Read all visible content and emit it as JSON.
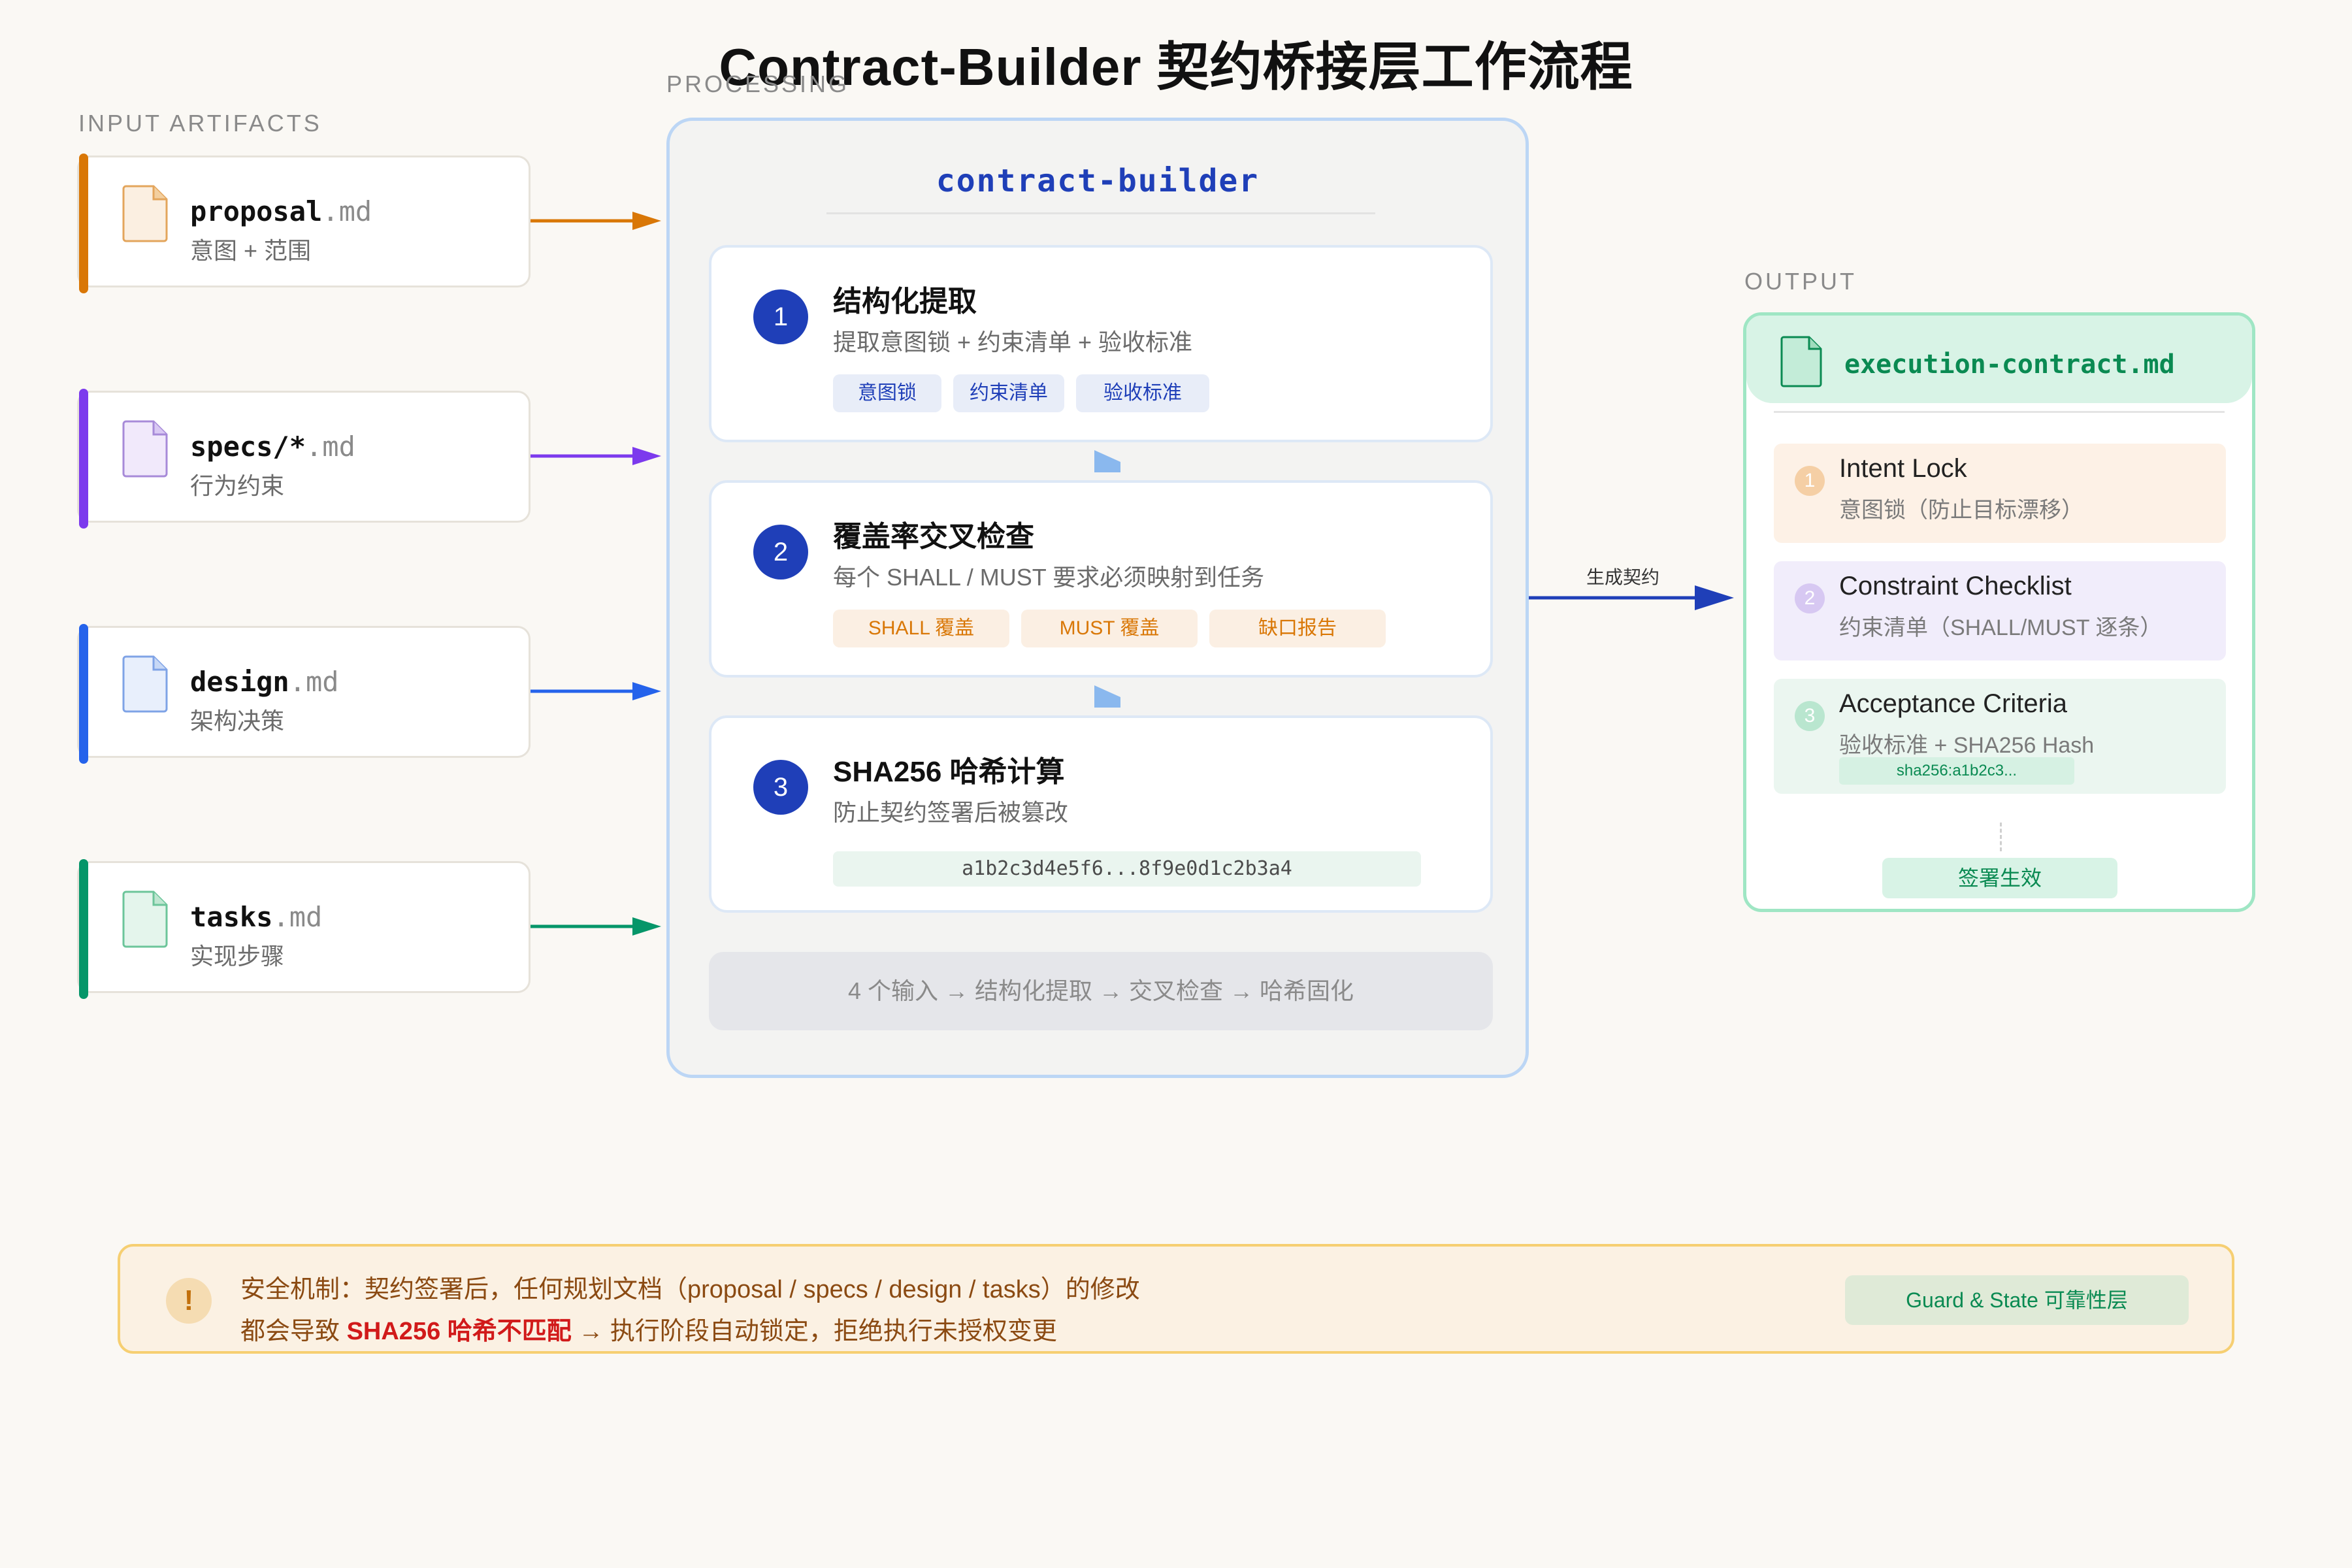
{
  "title": "Contract-Builder 契约桥接层工作流程",
  "sections": {
    "input": "INPUT ARTIFACTS",
    "processing": "PROCESSING",
    "output": "OUTPUT"
  },
  "colors": {
    "proposal": "#d97706",
    "specs": "#7c3aed",
    "design": "#2563eb",
    "tasks": "#059669",
    "primary": "#1f3fb8"
  },
  "inputs": [
    {
      "name": "proposal",
      "ext": ".md",
      "desc": "意图 + 范围",
      "icon": "file-icon"
    },
    {
      "name": "specs/*",
      "ext": ".md",
      "desc": "行为约束",
      "icon": "file-icon"
    },
    {
      "name": "design",
      "ext": ".md",
      "desc": "架构决策",
      "icon": "file-icon"
    },
    {
      "name": "tasks",
      "ext": ".md",
      "desc": "实现步骤",
      "icon": "file-icon"
    }
  ],
  "processor": {
    "name": "contract-builder",
    "steps": [
      {
        "num": "1",
        "title": "结构化提取",
        "desc": "提取意图锁 + 约束清单 + 验收标准",
        "tags": [
          "意图锁",
          "约束清单",
          "验收标准"
        ]
      },
      {
        "num": "2",
        "title": "覆盖率交叉检查",
        "desc": "每个 SHALL / MUST 要求必须映射到任务",
        "tags": [
          "SHALL 覆盖",
          "MUST 覆盖",
          "缺口报告"
        ]
      },
      {
        "num": "3",
        "title": "SHA256 哈希计算",
        "desc": "防止契约签署后被篡改",
        "hash": "a1b2c3d4e5f6...8f9e0d1c2b3a4"
      }
    ],
    "summary": "4 个输入 → 结构化提取 → 交叉检查 → 哈希固化"
  },
  "connector_label": "生成契约",
  "output": {
    "filename": "execution-contract.md",
    "items": [
      {
        "num": "1",
        "title": "Intent Lock",
        "desc": "意图锁（防止目标漂移）"
      },
      {
        "num": "2",
        "title": "Constraint Checklist",
        "desc": "约束清单（SHALL/MUST 逐条）"
      },
      {
        "num": "3",
        "title": "Acceptance Criteria",
        "desc": "验收标准 + SHA256 Hash",
        "hash": "sha256:a1b2c3..."
      }
    ],
    "sign": "签署生效"
  },
  "notice": {
    "icon": "!",
    "line1": "安全机制：契约签署后，任何规划文档（proposal / specs / design / tasks）的修改",
    "line2_pre": "都会导致",
    "line2_emph": "SHA256 哈希不匹配",
    "line2_post": "→ 执行阶段自动锁定，拒绝执行未授权变更",
    "badge": "Guard & State 可靠性层"
  }
}
